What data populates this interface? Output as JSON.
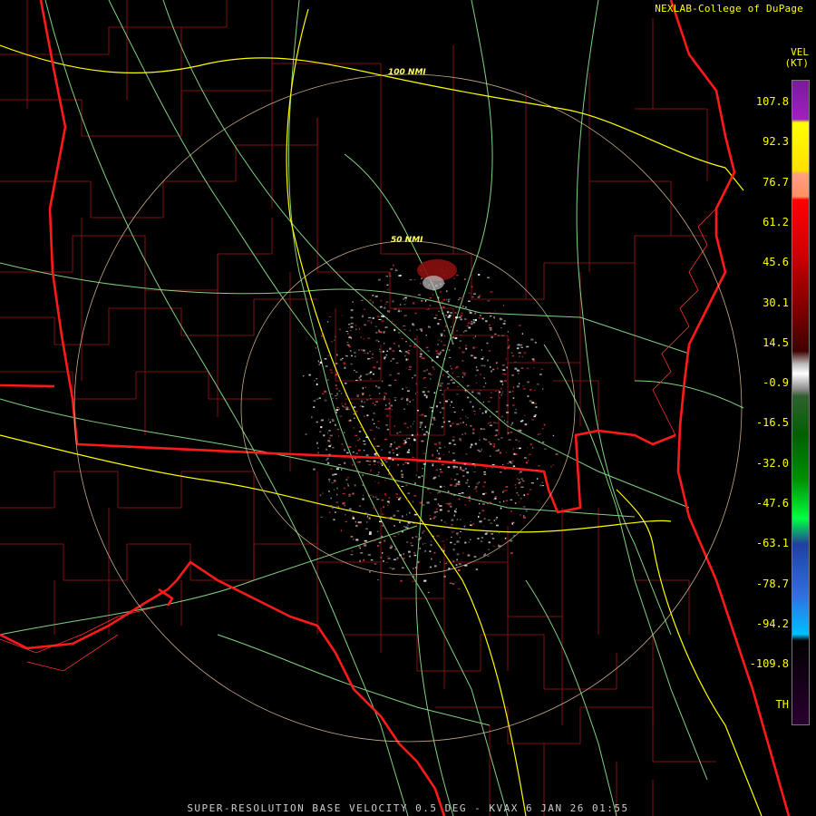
{
  "header": {
    "credit": "NEXLAB-College of DuPage"
  },
  "legend": {
    "title_line1": "VEL",
    "title_line2": "(KT)",
    "labels": [
      "107.8",
      "92.3",
      "76.7",
      "61.2",
      "45.6",
      "30.1",
      "14.5",
      "-0.9",
      "-16.5",
      "-32.0",
      "-47.6",
      "-63.1",
      "-78.7",
      "-94.2",
      "-109.8",
      "TH"
    ]
  },
  "range_rings": [
    "100 NMI",
    "50 NMI"
  ],
  "footer": {
    "product": "SUPER-RESOLUTION BASE VELOCITY 0.5 DEG - KVAX 6 JAN 26 01:55"
  },
  "colors": {
    "background": "#000000",
    "state_border": "#ff2020",
    "county_border": "#b01818",
    "interstate": "#ffff00",
    "highway": "#98f098",
    "range_ring": "#e0c0a0",
    "text": "#ffff00"
  }
}
